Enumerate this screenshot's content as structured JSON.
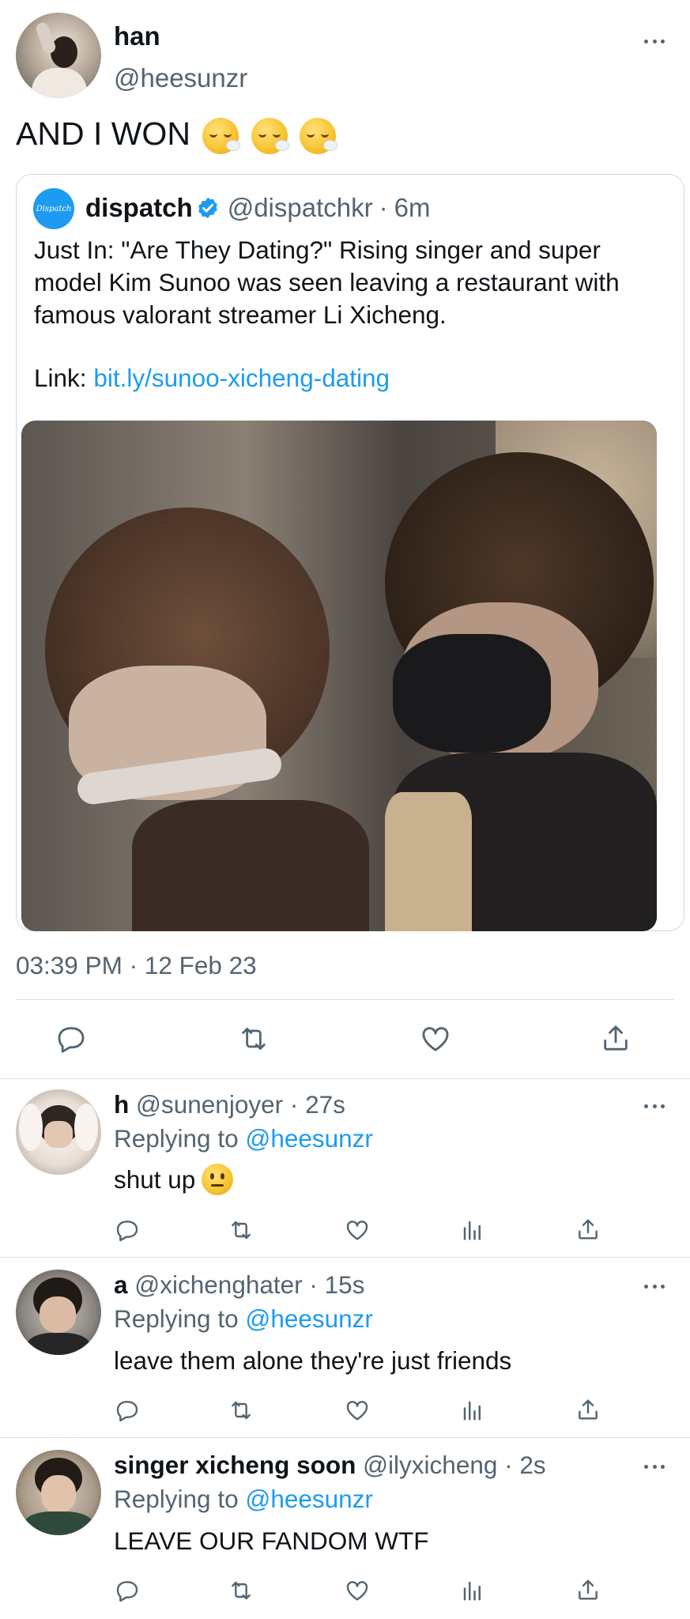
{
  "main_tweet": {
    "display_name": "han",
    "handle": "@heesunzr",
    "text": "AND I WON",
    "emoji": [
      "face-exhaling-emoji",
      "face-exhaling-emoji",
      "face-exhaling-emoji"
    ],
    "timestamp": "03:39 PM · 12 Feb 23"
  },
  "quoted_tweet": {
    "avatar_text": "Dispatch",
    "display_name": "dispatch",
    "handle": "@dispatchkr",
    "separator": "·",
    "time": "6m",
    "text": "Just In: \"Are They Dating?\" Rising singer and super model Kim Sunoo was seen leaving a restaurant with famous valorant streamer Li Xicheng.",
    "link_label": "Link:",
    "link_url": "bit.ly/sunoo-xicheng-dating"
  },
  "replies": [
    {
      "display_name": "h",
      "handle": "@sunenjoyer",
      "time": "· 27s",
      "replying_label": "Replying to",
      "replying_handle": "@heesunzr",
      "text": "shut up",
      "emoji": "neutral-face-emoji"
    },
    {
      "display_name": "a",
      "handle": "@xichenghater",
      "time": "· 15s",
      "replying_label": "Replying to",
      "replying_handle": "@heesunzr",
      "text": "leave them alone they're just friends"
    },
    {
      "display_name": "singer xicheng soon",
      "handle": "@ilyxicheng",
      "time": "· 2s",
      "replying_label": "Replying to",
      "replying_handle": "@heesunzr",
      "text": "LEAVE OUR FANDOM WTF"
    }
  ],
  "colors": {
    "link": "#1d9bf0",
    "muted": "#536471",
    "verified": "#1d9bf0",
    "divider": "#d9dee2"
  }
}
